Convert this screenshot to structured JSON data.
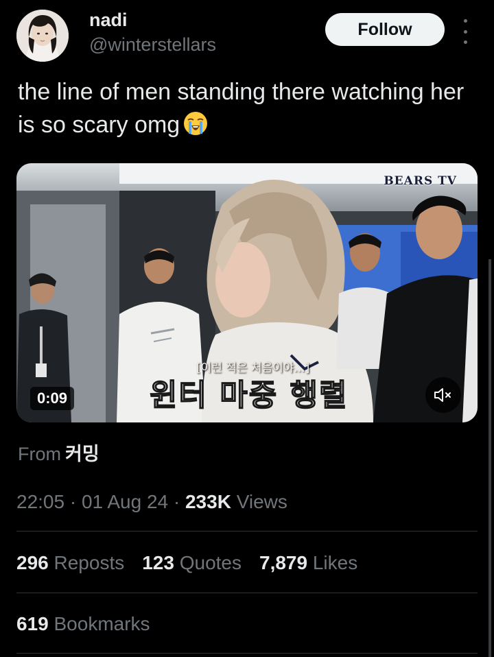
{
  "author": {
    "display_name": "nadi",
    "handle": "@winterstellars",
    "avatar_icon": "profile-avatar"
  },
  "actions": {
    "follow_label": "Follow",
    "more_icon": "vertical-dots-icon"
  },
  "tweet": {
    "text": "the line of men standing there watching her is so scary omg",
    "emoji_icon": "loudly-crying-face-emoji"
  },
  "media": {
    "watermark": "BEARS TV",
    "caption_small": "[이런 적은 처음이야...]",
    "caption_big": "윈터 마중 행렬",
    "duration": "0:09",
    "mute_icon": "speaker-muted-icon"
  },
  "source": {
    "prefix": "From",
    "name": "커밍"
  },
  "meta": {
    "time": "22:05",
    "date": "01 Aug 24",
    "views_count": "233K",
    "views_label": "Views"
  },
  "stats": {
    "reposts_count": "296",
    "reposts_label": "Reposts",
    "quotes_count": "123",
    "quotes_label": "Quotes",
    "likes_count": "7,879",
    "likes_label": "Likes",
    "bookmarks_count": "619",
    "bookmarks_label": "Bookmarks"
  },
  "colors": {
    "background": "#000000",
    "primary_text": "#e7e9ea",
    "secondary_text": "#71767b",
    "follow_button": "#eff3f4",
    "divider": "#2f3336"
  }
}
